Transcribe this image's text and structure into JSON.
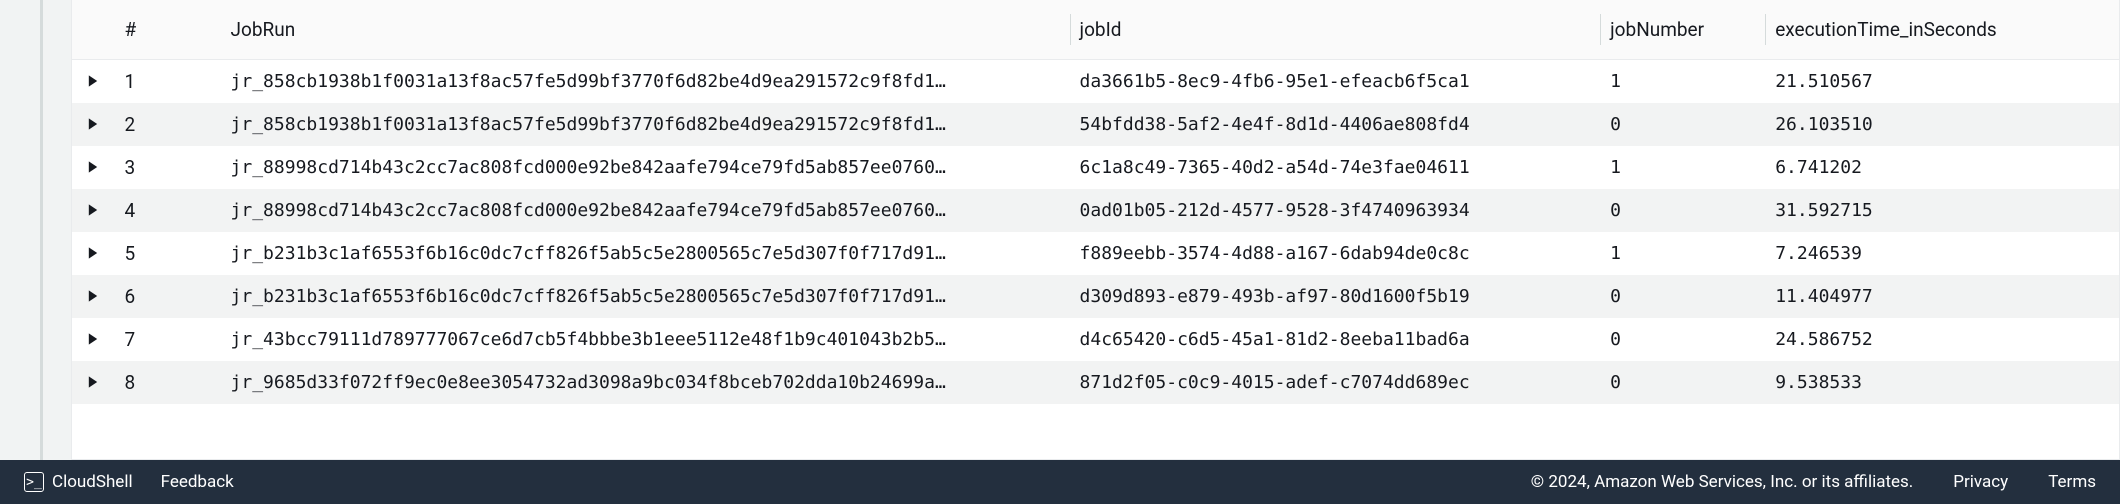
{
  "columns": {
    "index": "#",
    "jobRun": "JobRun",
    "jobId": "jobId",
    "jobNumber": "jobNumber",
    "execTime": "executionTime_inSeconds"
  },
  "rows": [
    {
      "idx": "1",
      "jobRun": "jr_858cb1938b1f0031a13f8ac57fe5d99bf3770f6d82be4d9ea291572c9f8fd1…",
      "jobId": "da3661b5-8ec9-4fb6-95e1-efeacb6f5ca1",
      "jobNumber": "1",
      "exec": "21.510567"
    },
    {
      "idx": "2",
      "jobRun": "jr_858cb1938b1f0031a13f8ac57fe5d99bf3770f6d82be4d9ea291572c9f8fd1…",
      "jobId": "54bfdd38-5af2-4e4f-8d1d-4406ae808fd4",
      "jobNumber": "0",
      "exec": "26.103510"
    },
    {
      "idx": "3",
      "jobRun": "jr_88998cd714b43c2cc7ac808fcd000e92be842aafe794ce79fd5ab857ee0760…",
      "jobId": "6c1a8c49-7365-40d2-a54d-74e3fae04611",
      "jobNumber": "1",
      "exec": "6.741202"
    },
    {
      "idx": "4",
      "jobRun": "jr_88998cd714b43c2cc7ac808fcd000e92be842aafe794ce79fd5ab857ee0760…",
      "jobId": "0ad01b05-212d-4577-9528-3f4740963934",
      "jobNumber": "0",
      "exec": "31.592715"
    },
    {
      "idx": "5",
      "jobRun": "jr_b231b3c1af6553f6b16c0dc7cff826f5ab5c5e2800565c7e5d307f0f717d91…",
      "jobId": "f889eebb-3574-4d88-a167-6dab94de0c8c",
      "jobNumber": "1",
      "exec": "7.246539"
    },
    {
      "idx": "6",
      "jobRun": "jr_b231b3c1af6553f6b16c0dc7cff826f5ab5c5e2800565c7e5d307f0f717d91…",
      "jobId": "d309d893-e879-493b-af97-80d1600f5b19",
      "jobNumber": "0",
      "exec": "11.404977"
    },
    {
      "idx": "7",
      "jobRun": "jr_43bcc79111d789777067ce6d7cb5f4bbbe3b1eee5112e48f1b9c401043b2b5…",
      "jobId": "d4c65420-c6d5-45a1-81d2-8eeba11bad6a",
      "jobNumber": "0",
      "exec": "24.586752"
    },
    {
      "idx": "8",
      "jobRun": "jr_9685d33f072ff9ec0e8ee3054732ad3098a9bc034f8bceb702dda10b24699a…",
      "jobId": "871d2f05-c0c9-4015-adef-c7074dd689ec",
      "jobNumber": "0",
      "exec": "9.538533"
    }
  ],
  "footer": {
    "cloudshell": "CloudShell",
    "feedback": "Feedback",
    "copyright": "© 2024, Amazon Web Services, Inc. or its affiliates.",
    "privacy": "Privacy",
    "terms": "Terms"
  }
}
